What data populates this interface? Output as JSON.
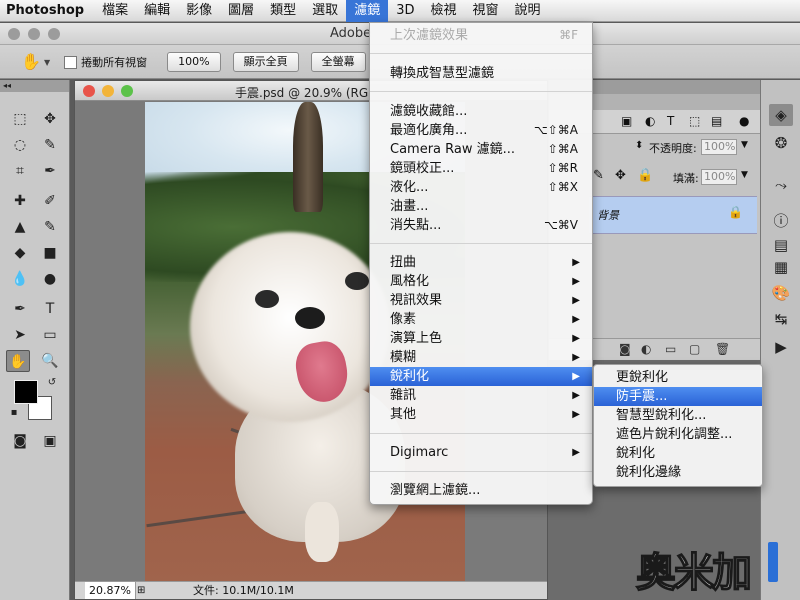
{
  "menubar": {
    "app": "Photoshop",
    "items": [
      "檔案",
      "編輯",
      "影像",
      "圖層",
      "類型",
      "選取",
      "濾鏡",
      "3D",
      "檢視",
      "視窗",
      "說明"
    ],
    "active_index": 6
  },
  "options_bar": {
    "app_title": "Adobe",
    "scroll_all_label": "捲動所有視窗",
    "btn_100": "100%",
    "btn_fit": "顯示全頁",
    "btn_fill": "全螢幕"
  },
  "document": {
    "title": "手震.psd @ 20.9% (RG",
    "zoom": "20.87%",
    "info": "文件: 10.1M/10.1M"
  },
  "layers_panel": {
    "opacity_label": "不透明度:",
    "opacity_value": "100%",
    "fill_label": "填滿:",
    "fill_value": "100%",
    "layer_name": "背景"
  },
  "filter_menu": {
    "last_filter": {
      "label": "上次濾鏡效果",
      "shortcut": "⌘F"
    },
    "smart": "轉換成智慧型濾鏡",
    "group1": [
      {
        "label": "濾鏡收藏館...",
        "shortcut": ""
      },
      {
        "label": "最適化廣角...",
        "shortcut": "⌥⇧⌘A"
      },
      {
        "label": "Camera Raw 濾鏡...",
        "shortcut": "⇧⌘A"
      },
      {
        "label": "鏡頭校正...",
        "shortcut": "⇧⌘R"
      },
      {
        "label": "液化...",
        "shortcut": "⇧⌘X"
      },
      {
        "label": "油畫...",
        "shortcut": ""
      },
      {
        "label": "消失點...",
        "shortcut": "⌥⌘V"
      }
    ],
    "group2": [
      "扭曲",
      "風格化",
      "視訊效果",
      "像素",
      "演算上色",
      "模糊",
      "銳利化",
      "雜訊",
      "其他"
    ],
    "highlight_index": 6,
    "digimarc": "Digimarc",
    "browse": "瀏覽網上濾鏡..."
  },
  "sharpen_submenu": {
    "items": [
      "更銳利化",
      "防手震...",
      "智慧型銳利化...",
      "遮色片銳利化調整...",
      "銳利化",
      "銳利化邊緣"
    ],
    "highlight_index": 1
  },
  "watermark": "奥米加"
}
